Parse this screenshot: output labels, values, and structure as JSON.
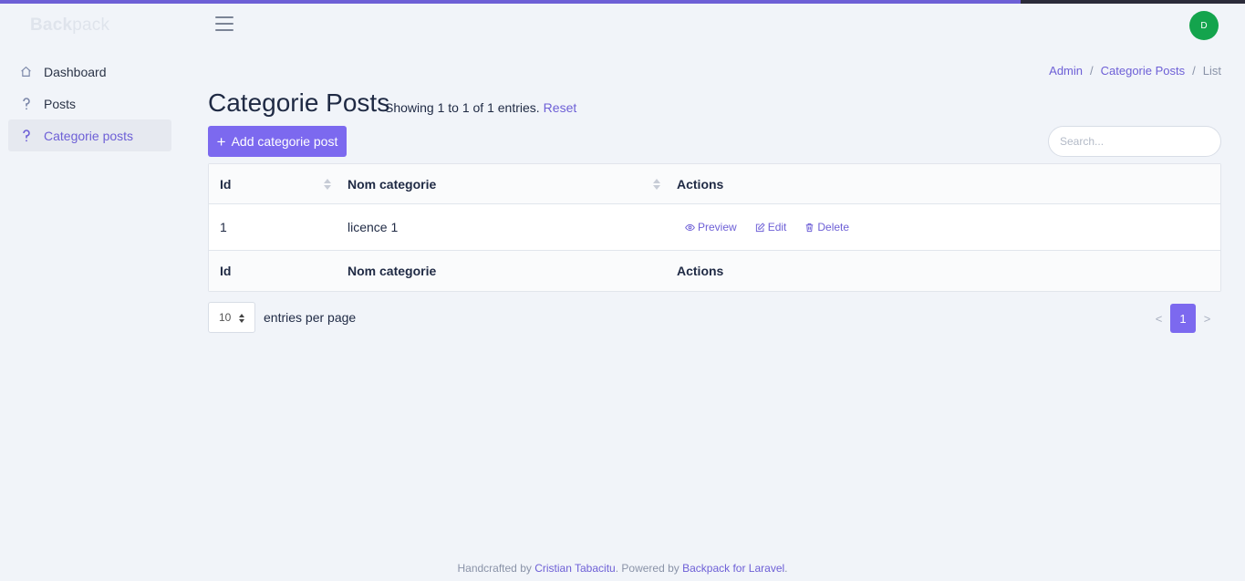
{
  "brand": {
    "bold": "Back",
    "rest": "pack"
  },
  "user": {
    "initial": "D"
  },
  "sidebar": {
    "items": [
      {
        "label": "Dashboard",
        "icon": "home-icon"
      },
      {
        "label": "Posts",
        "icon": "question-icon"
      },
      {
        "label": "Categorie posts",
        "icon": "question-icon",
        "active": true
      }
    ]
  },
  "breadcrumb": {
    "items": [
      "Admin",
      "Categorie Posts",
      "List"
    ],
    "separator": "/"
  },
  "page": {
    "title": "Categorie Posts",
    "showing": "Showing 1 to 1 of 1 entries.",
    "reset": "Reset"
  },
  "toolbar": {
    "add_label": "Add categorie post"
  },
  "search": {
    "placeholder": "Search..."
  },
  "table": {
    "columns": [
      "Id",
      "Nom categorie",
      "Actions"
    ],
    "rows": [
      {
        "id": "1",
        "nom": "licence 1",
        "actions": [
          "Preview",
          "Edit",
          "Delete"
        ]
      }
    ]
  },
  "pagination": {
    "per_page": "10",
    "per_page_label": "entries per page",
    "prev": "<",
    "current": "1",
    "next": ">"
  },
  "footer": {
    "prefix": "Handcrafted by",
    "author": "Cristian Tabacitu",
    "middle": ". Powered by",
    "product": "Backpack for Laravel",
    "suffix": "."
  },
  "colors": {
    "accent": "#7c69ef",
    "link": "#6d5fd6",
    "avatar": "#14a44d",
    "background": "#f1f4f9"
  }
}
